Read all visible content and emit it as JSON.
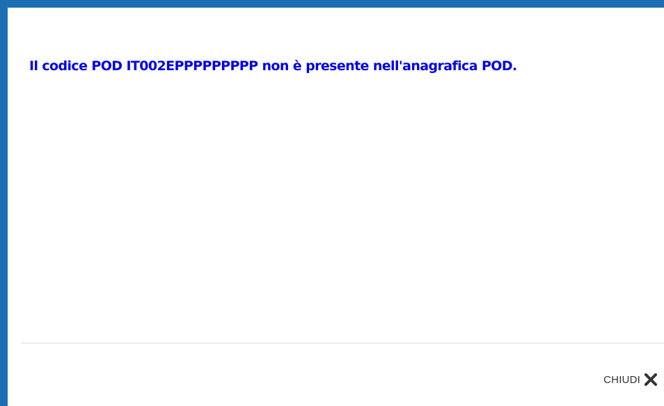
{
  "dialog": {
    "message": "Il codice POD IT002EPPPPPPPPP non è presente nell'anagrafica POD.",
    "close_label": "CHIUDI",
    "close_icon": "close-icon"
  },
  "colors": {
    "frame_border": "#1b6fb2",
    "message_text": "#0000ee",
    "close_text": "#333333",
    "divider": "#dddddd"
  }
}
